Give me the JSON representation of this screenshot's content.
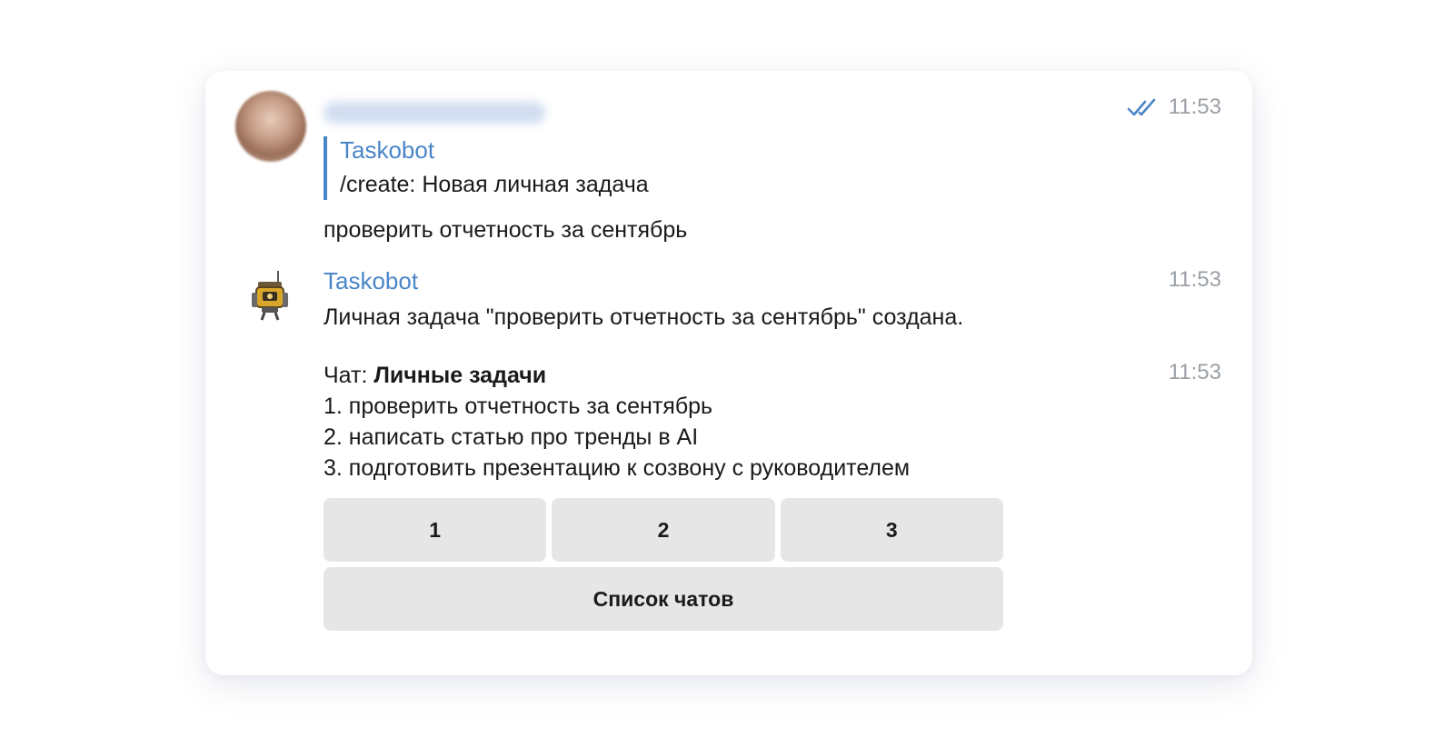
{
  "message1": {
    "time": "11:53",
    "reply": {
      "name": "Taskobot",
      "text": "/create: Новая личная задача"
    },
    "text": "проверить отчетность за сентябрь"
  },
  "message2": {
    "sender": "Taskobot",
    "time": "11:53",
    "text": "Личная задача \"проверить отчетность за сентябрь\" создана."
  },
  "message3": {
    "time": "11:53",
    "chat_prefix": "Чат: ",
    "chat_name": "Личные задачи",
    "items": [
      "1. проверить отчетность за сентябрь",
      "2. написать статью про тренды в AI",
      "3. подготовить презентацию к созвону с руководителем"
    ],
    "buttons": [
      "1",
      "2",
      "3"
    ],
    "wide_button": "Список чатов"
  },
  "colors": {
    "accent": "#4a86c8",
    "button_bg": "#e6e6e6",
    "timestamp": "#9aa0a6"
  },
  "icons": {
    "read_status": "double-check-icon",
    "bot_avatar": "robot-icon"
  }
}
